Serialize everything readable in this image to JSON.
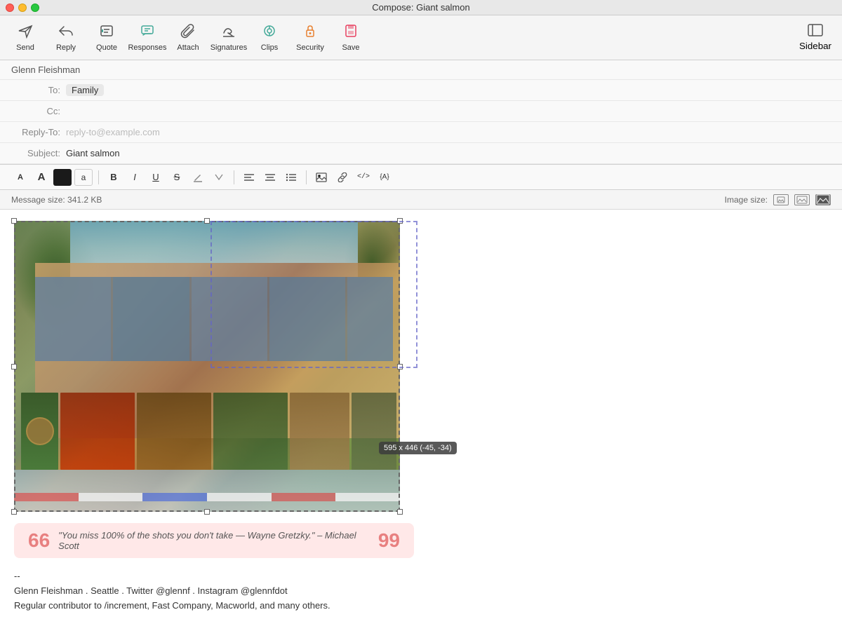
{
  "window": {
    "title": "Compose: Giant salmon"
  },
  "toolbar": {
    "send_label": "Send",
    "reply_label": "Reply",
    "quote_label": "Quote",
    "responses_label": "Responses",
    "attach_label": "Attach",
    "signatures_label": "Signatures",
    "clips_label": "Clips",
    "security_label": "Security",
    "save_label": "Save",
    "sidebar_label": "Sidebar"
  },
  "header": {
    "from": "Glenn Fleishman",
    "to": "Family",
    "cc": "",
    "reply_to_placeholder": "reply-to@example.com",
    "subject": "Giant salmon",
    "to_label": "To:",
    "cc_label": "Cc:",
    "reply_to_label": "Reply-To:",
    "subject_label": "Subject:"
  },
  "format_toolbar": {
    "font_smaller": "A",
    "font_larger": "A",
    "color_swatch": "#1a1a1a",
    "letter_a": "a",
    "bold": "B",
    "italic": "I",
    "underline": "U",
    "strikethrough": "S",
    "link": "🔗",
    "highlight": "✏",
    "align_left": "≡",
    "align_center": "≡",
    "list": "≡",
    "image": "🖼",
    "hyperlink": "🔗",
    "code": "</>",
    "variable": "{A}"
  },
  "status": {
    "message_size_label": "Message size:",
    "message_size_value": "341.2 KB",
    "image_size_label": "Image size:"
  },
  "image": {
    "tooltip": "595 x 446 (-45, -34)"
  },
  "quote": {
    "left_mark": "66",
    "text": "\"You miss 100% of the shots you don't take — Wayne Gretzky.\" – Michael Scott",
    "right_mark": "99"
  },
  "signature": {
    "dash": "--",
    "line1": "Glenn Fleishman . Seattle . Twitter @glennf . Instagram @glennfdot",
    "line2_start": "Regular contributor to /increment, Fast Company, Macworld, and many others."
  }
}
